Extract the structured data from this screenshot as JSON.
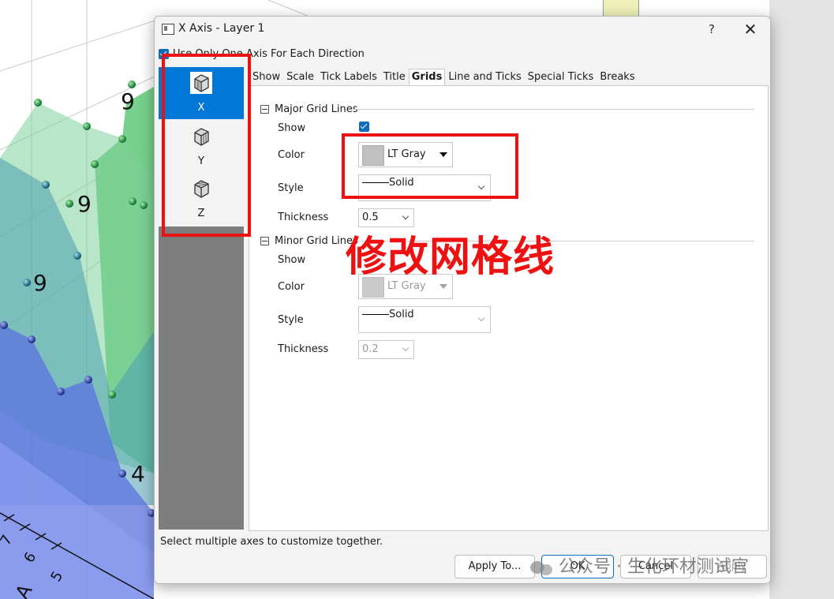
{
  "background_plot": {
    "point_labels": [
      "9",
      "9",
      "9",
      "4"
    ],
    "axis_tick_labels": [
      "7",
      "6",
      "5"
    ],
    "axis_letter": "A"
  },
  "dialog": {
    "title": "X Axis - Layer 1",
    "help_label": "?",
    "close_label": "✕",
    "use_one_axis_label": "Use Only One Axis For Each Direction",
    "use_one_axis_checked": true,
    "axes": [
      {
        "label": "X",
        "selected": true
      },
      {
        "label": "Y",
        "selected": false
      },
      {
        "label": "Z",
        "selected": false
      }
    ],
    "tabs": [
      {
        "label": "Show",
        "active": false
      },
      {
        "label": "Scale",
        "active": false
      },
      {
        "label": "Tick Labels",
        "active": false
      },
      {
        "label": "Title",
        "active": false
      },
      {
        "label": "Grids",
        "active": true
      },
      {
        "label": "Line and Ticks",
        "active": false
      },
      {
        "label": "Special Ticks",
        "active": false
      },
      {
        "label": "Breaks",
        "active": false
      }
    ],
    "major": {
      "heading": "Major Grid Lines",
      "show_label": "Show",
      "show_checked": true,
      "color_label": "Color",
      "color_value": "LT Gray",
      "style_label": "Style",
      "style_value": "Solid",
      "thickness_label": "Thickness",
      "thickness_value": "0.5"
    },
    "minor": {
      "heading": "Minor Grid Lines",
      "show_label": "Show",
      "color_label": "Color",
      "color_value": "LT Gray",
      "style_label": "Style",
      "style_value": "Solid",
      "thickness_label": "Thickness",
      "thickness_value": "0.2"
    },
    "status_text": "Select multiple axes to customize together.",
    "buttons": {
      "apply_to": "Apply To...",
      "ok": "OK",
      "cancel": "Cancel",
      "apply": "Apply"
    }
  },
  "annotation": {
    "caption": "修改网格线",
    "color": "#ee1111"
  },
  "watermark": {
    "text": "公众号 · 生化环材测试官"
  },
  "colors": {
    "accent": "#0078d7",
    "checkbox": "#0f6cbd",
    "gray_swatch": "#c0c0c0"
  }
}
